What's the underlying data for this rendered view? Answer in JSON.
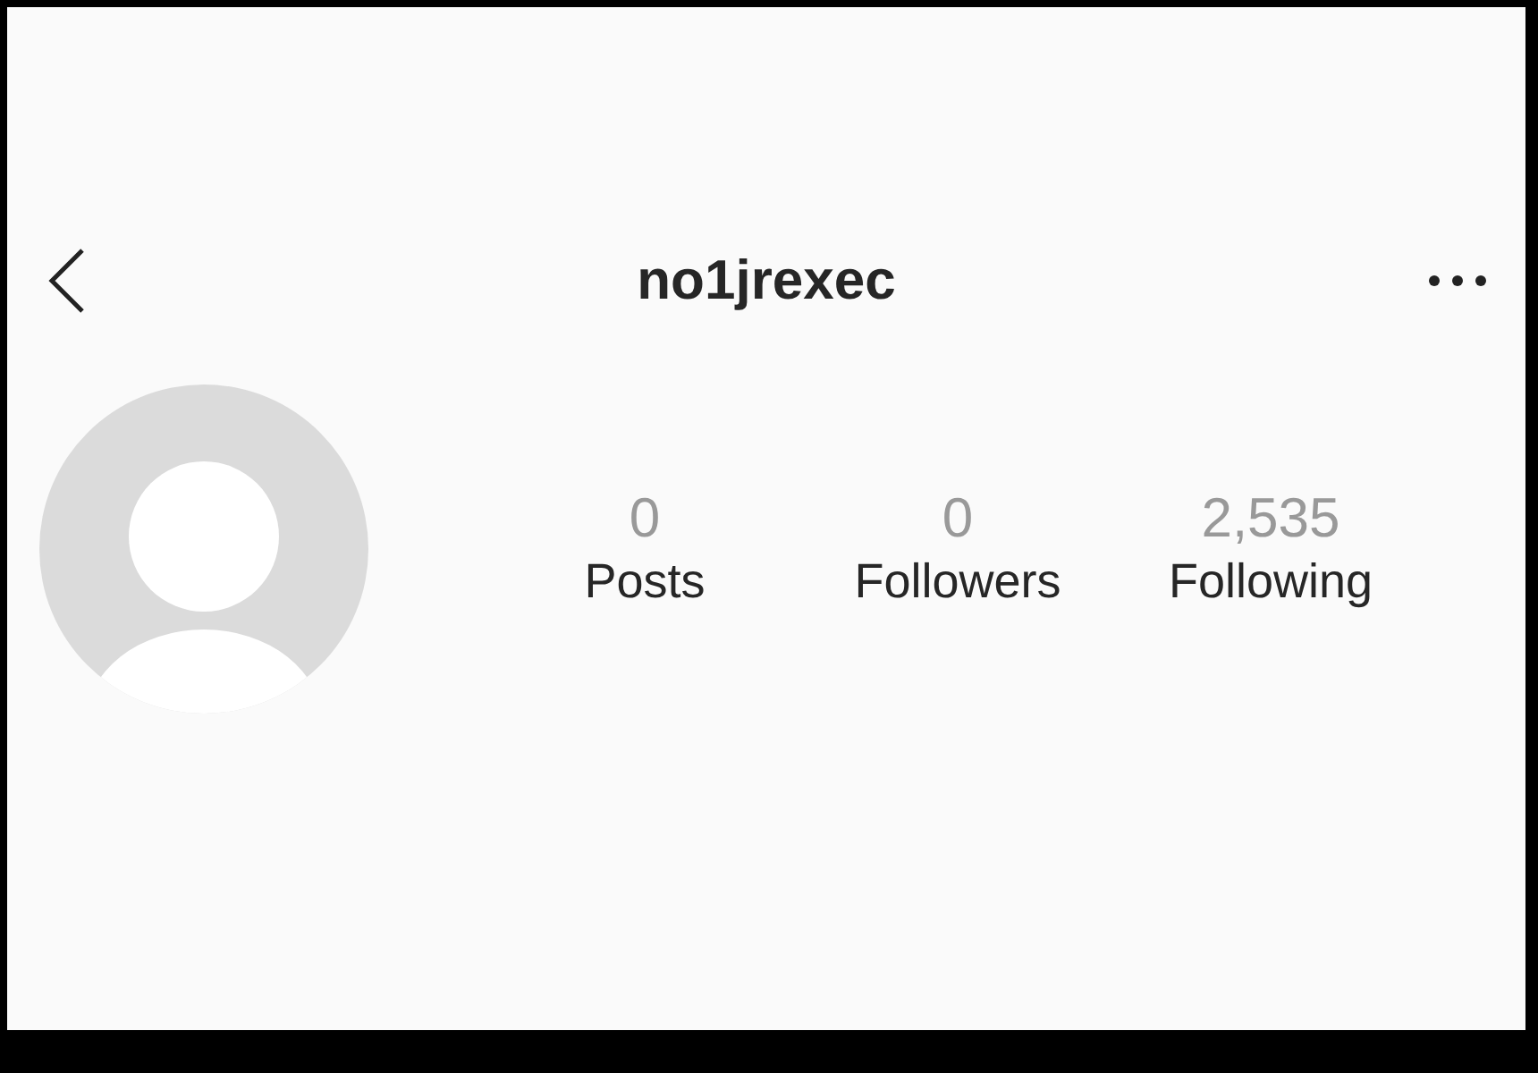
{
  "header": {
    "username": "no1jrexec"
  },
  "stats": [
    {
      "value": "0",
      "label": "Posts"
    },
    {
      "value": "0",
      "label": "Followers"
    },
    {
      "value": "2,535",
      "label": "Following"
    }
  ]
}
